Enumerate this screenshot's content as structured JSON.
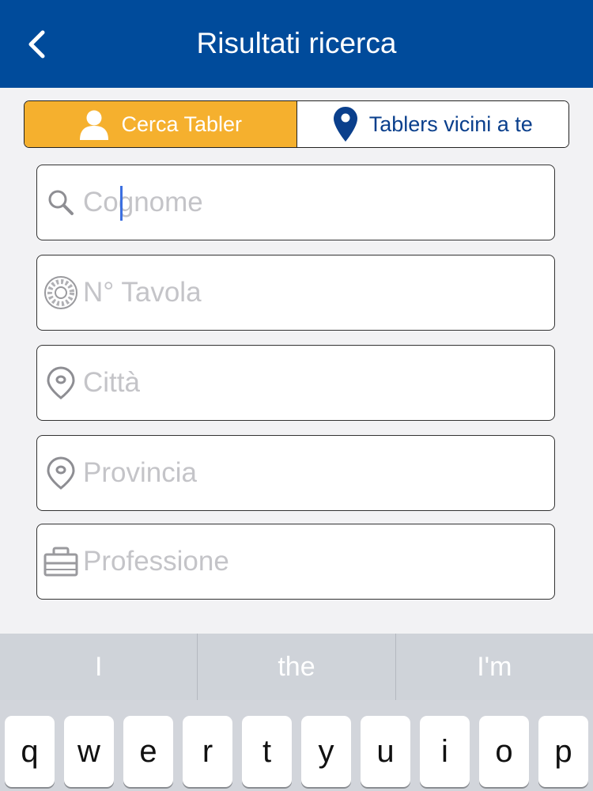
{
  "header": {
    "title": "Risultati ricerca",
    "back_icon": "chevron-left-icon",
    "background": "#004b9b"
  },
  "segment": {
    "active_label": "Cerca Tabler",
    "active_icon": "person-icon",
    "inactive_label": "Tablers vicini a te",
    "inactive_icon": "location-pin-icon",
    "active_color": "#f5b02e"
  },
  "fields": {
    "cognome": {
      "placeholder": "Cognome",
      "value": "",
      "icon": "search-icon"
    },
    "tavola": {
      "placeholder": "N° Tavola",
      "value": "",
      "icon": "round-table-logo-icon"
    },
    "citta": {
      "placeholder": "Città",
      "value": "",
      "icon": "location-pin-outline-icon"
    },
    "provincia": {
      "placeholder": "Provincia",
      "value": "",
      "icon": "location-pin-outline-icon"
    },
    "professione": {
      "placeholder": "Professione",
      "value": "",
      "icon": "briefcase-icon"
    }
  },
  "keyboard": {
    "suggestions": [
      "I",
      "the",
      "I'm"
    ],
    "row1": [
      "q",
      "w",
      "e",
      "r",
      "t",
      "y",
      "u",
      "i",
      "o",
      "p"
    ]
  }
}
